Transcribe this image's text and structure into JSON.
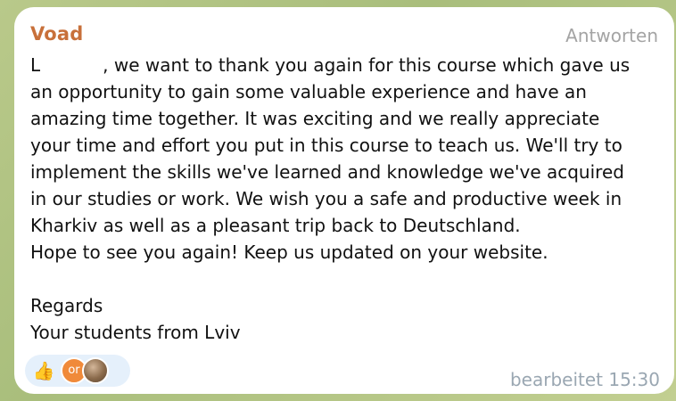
{
  "message": {
    "sender": "Voad",
    "reply_label": "Antworten",
    "lines": [
      "L",
      ", we want to thank you again for this course which gave us",
      "an opportunity to gain some valuable experience and have an",
      "amazing time together. It was exciting and we really appreciate",
      "your time and effort you put in this course to teach us. We'll try to",
      "implement the skills we've learned and knowledge we've acquired",
      "in our studies or work. We wish you a safe and productive week in",
      "Kharkiv as well as a pleasant trip back to Deutschland.",
      "Hope to see you again! Keep us updated on your website.",
      "Regards",
      "Your students from Lviv"
    ],
    "edited_time": "bearbeitet 15:30"
  },
  "reactions": {
    "emoji_icon": "thumbs-up-icon",
    "emoji_glyph": "👍",
    "avatar_initials": "or",
    "avatar_color": "#f08a3a"
  },
  "colors": {
    "sender": "#c8703a",
    "bubble": "#ffffff",
    "background": "#b9c98a",
    "meta_text": "#9aa7b2"
  }
}
